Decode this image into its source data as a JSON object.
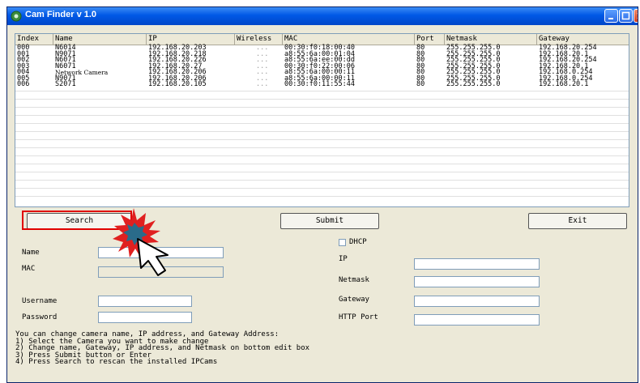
{
  "window": {
    "title": "Cam Finder v 1.0",
    "colors": {
      "titlebar": "#0058e6",
      "face": "#ece9d8",
      "highlight": "#e00000",
      "burst": "#e02020",
      "burst_center": "#2a6b8a"
    },
    "icons": [
      "app-camera-icon",
      "minimize-icon",
      "maximize-icon",
      "close-icon",
      "click-burst-icon",
      "cursor-arrow-icon"
    ]
  },
  "table": {
    "columns": [
      "Index",
      "Name",
      "IP",
      "Wireless",
      "MAC",
      "Port",
      "Netmask",
      "Gateway"
    ],
    "rows": [
      [
        "000",
        "N6014",
        "192.168.20.203",
        "...",
        "00:30:f0:18:00:40",
        "80",
        "255.255.255.0",
        "192.168.20.254"
      ],
      [
        "001",
        "N9071",
        "192.168.20.218",
        "...",
        "a8:55:6a:00:01:04",
        "80",
        "255.255.255.0",
        "192.168.20.1"
      ],
      [
        "002",
        "N6071",
        "192.168.20.226",
        "...",
        "a8:55:6a:ee:00:dd",
        "80",
        "255.255.255.0",
        "192.168.20.254"
      ],
      [
        "003",
        "N6071",
        "192.168.20.27",
        "...",
        "00:30:f0:22:00:06",
        "80",
        "255.255.255.0",
        "192.168.20.1"
      ],
      [
        "004",
        "Network Camera",
        "192.168.20.206",
        "...",
        "a8:55:6a:00:00:11",
        "80",
        "255.255.255.0",
        "192.168.0.254"
      ],
      [
        "005",
        "N9071",
        "192.168.20.206",
        "...",
        "a8:55:6a:00:00:11",
        "80",
        "255.255.255.0",
        "192.168.0.254"
      ],
      [
        "006",
        "S2071",
        "192.168.20.105",
        "...",
        "00:30:f0:11:55:44",
        "80",
        "255.255.255.0",
        "192.168.20.1"
      ]
    ]
  },
  "buttons": {
    "search": "Search",
    "submit": "Submit",
    "exit": "Exit"
  },
  "form": {
    "name_label": "Name",
    "mac_label": "MAC",
    "username_label": "Username",
    "password_label": "Password",
    "dhcp_label": "DHCP",
    "ip_label": "IP",
    "netmask_label": "Netmask",
    "gateway_label": "Gateway",
    "http_port_label": "HTTP Port"
  },
  "instructions": [
    "You can change camera name, IP address, and Gateway Address:",
    "1) Select the Camera you want to make change",
    "2) Change name, Gateway, IP address, and Netmask on bottom edit box",
    "3) Press Submit button or Enter",
    "4) Press Search to rescan the installed IPCams"
  ]
}
